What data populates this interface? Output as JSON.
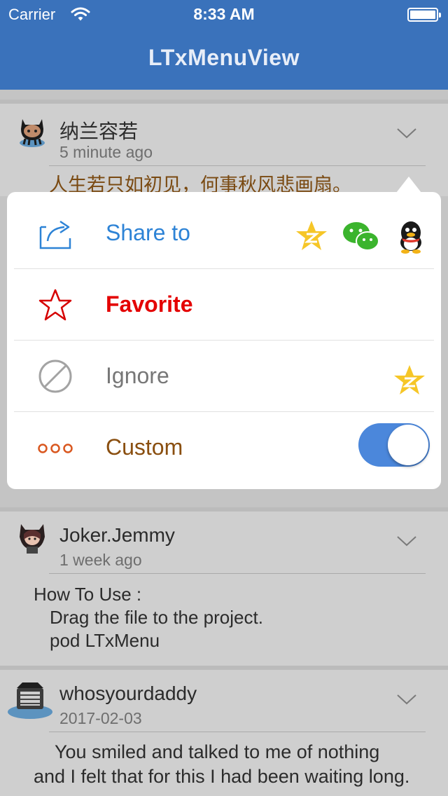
{
  "status_bar": {
    "carrier": "Carrier",
    "time": "8:33 AM"
  },
  "nav": {
    "title": "LTxMenuView"
  },
  "posts": [
    {
      "name": "纳兰容若",
      "time": "5 minute ago",
      "content_lines": [
        "人生若只如初见，何事秋风悲画扇。"
      ]
    },
    {
      "name": "Joker.Jemmy",
      "time": "1 week ago",
      "content_lines": [
        "How To Use :",
        "Drag the file to the project.",
        "pod LTxMenu"
      ]
    },
    {
      "name": "whosyourdaddy",
      "time": "2017-02-03",
      "content_lines": [
        "You smiled and talked to me of nothing",
        "and I felt that for this I had been waiting long."
      ]
    }
  ],
  "menu": {
    "items": [
      {
        "label": "Share to",
        "icon": "share-icon",
        "color": "#2d83d6",
        "share_targets": [
          "qzone-icon",
          "wechat-icon",
          "qq-icon"
        ]
      },
      {
        "label": "Favorite",
        "icon": "star-icon",
        "color": "#e40000"
      },
      {
        "label": "Ignore",
        "icon": "ignore-icon",
        "color": "#777777",
        "accessory": "qzone-icon"
      },
      {
        "label": "Custom",
        "icon": "more-dots-icon",
        "color": "#8a4f10",
        "toggle_on": true
      }
    ]
  },
  "colors": {
    "nav_bar": "#3a72bb",
    "toggle_on": "#4b87db",
    "qzone_star": "#f6c627",
    "wechat": "#3bb42d"
  }
}
